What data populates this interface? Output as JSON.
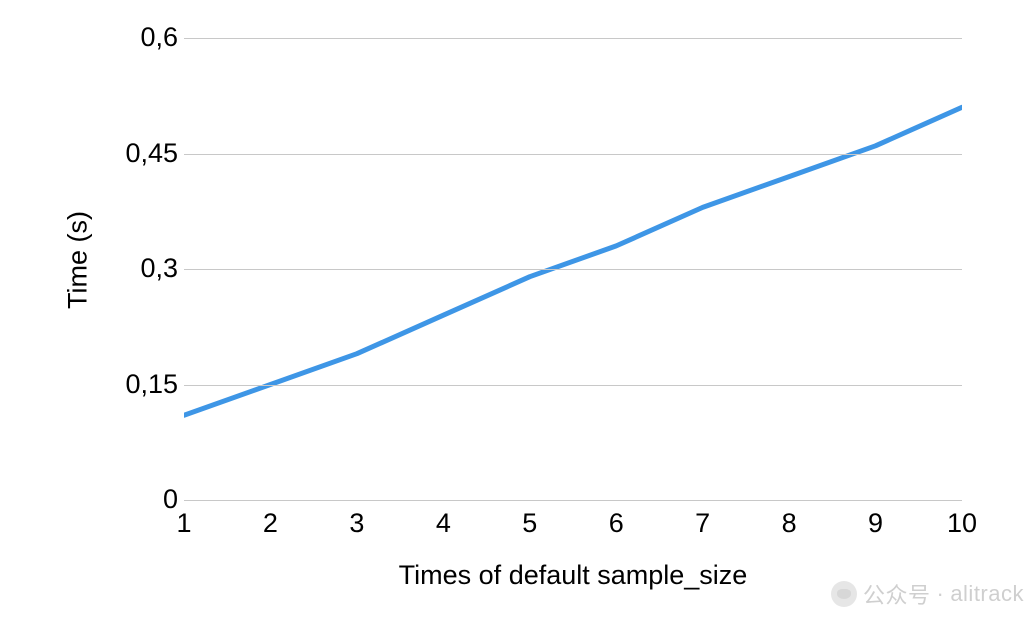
{
  "chart_data": {
    "type": "line",
    "x": [
      1,
      2,
      3,
      4,
      5,
      6,
      7,
      8,
      9,
      10
    ],
    "values": [
      0.11,
      0.15,
      0.19,
      0.24,
      0.29,
      0.33,
      0.38,
      0.42,
      0.46,
      0.51
    ],
    "title": "",
    "xlabel": "Times of default sample_size",
    "ylabel": "Time (s)",
    "xlim": [
      1,
      10
    ],
    "ylim": [
      0,
      0.6
    ],
    "xticks": [
      "1",
      "2",
      "3",
      "4",
      "5",
      "6",
      "7",
      "8",
      "9",
      "10"
    ],
    "yticks": [
      "0",
      "0,15",
      "0,3",
      "0,45",
      "0,6"
    ],
    "grid": true,
    "line_color": "#3e96e6"
  },
  "watermark": {
    "text_a": "公众号",
    "sep": "·",
    "text_b": "alitrack"
  }
}
